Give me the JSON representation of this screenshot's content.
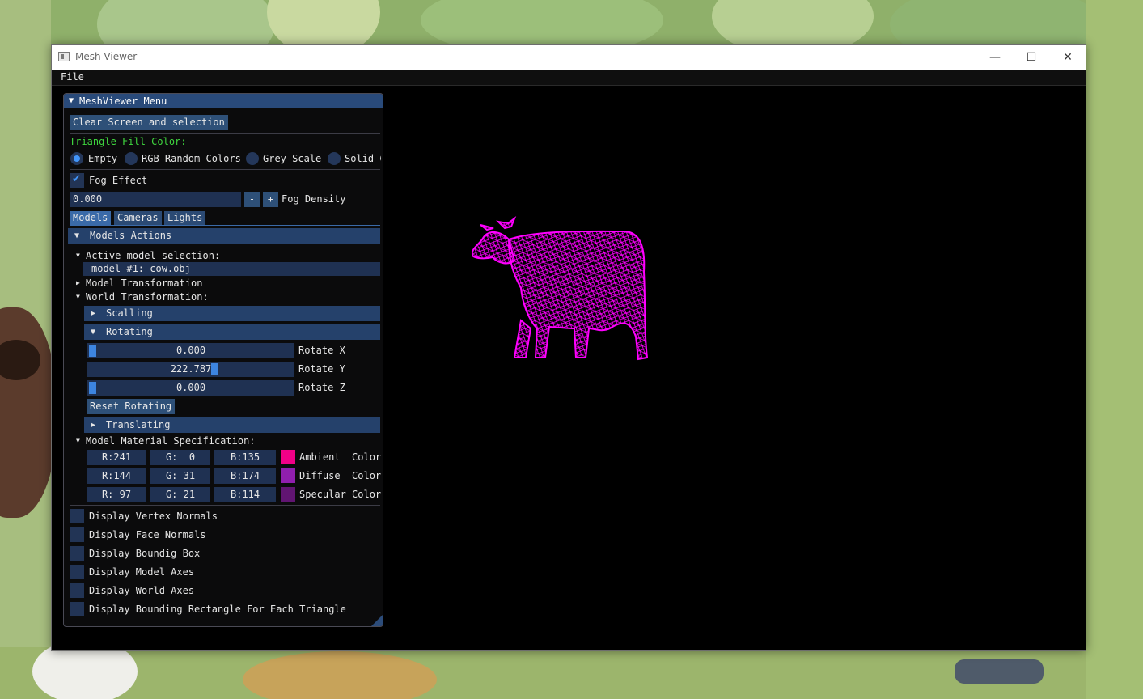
{
  "window": {
    "title": "Mesh Viewer",
    "controls": {
      "minimize": "—",
      "maximize": "☐",
      "close": "✕"
    }
  },
  "menubar": {
    "file": "File"
  },
  "panel": {
    "title": "MeshViewer Menu",
    "clear_button": "Clear Screen and selection",
    "fill_color_label": "Triangle Fill Color:",
    "fill_options": [
      "Empty",
      "RGB Random Colors",
      "Grey Scale",
      "Solid C"
    ],
    "fill_selected": "Empty",
    "fog": {
      "label": "Fog Effect",
      "checked": true,
      "density_value": "0.000",
      "minus": "-",
      "plus": "+",
      "density_label": "Fog Density"
    },
    "tabs": [
      "Models",
      "Cameras",
      "Lights"
    ],
    "active_tab": "Models",
    "models_actions": {
      "header": "Models Actions",
      "active_selection_label": "Active model selection:",
      "active_model": "model #1: cow.obj",
      "model_transformation": "Model Transformation",
      "world_transformation": "World Transformation:",
      "scalling": "Scalling",
      "rotating": "Rotating",
      "rotate": [
        {
          "value": "0.000",
          "label": "Rotate X",
          "fraction": 0.0
        },
        {
          "value": "222.787",
          "label": "Rotate Y",
          "fraction": 0.62
        },
        {
          "value": "0.000",
          "label": "Rotate Z",
          "fraction": 0.0
        }
      ],
      "reset_rotating": "Reset Rotating",
      "translating": "Translating",
      "material_label": "Model Material Specification:",
      "materials": [
        {
          "r": "R:241",
          "g": "G:  0",
          "b": "B:135",
          "label": "Ambient  Color",
          "color": "#f10087"
        },
        {
          "r": "R:144",
          "g": "G: 31",
          "b": "B:174",
          "label": "Diffuse  Color",
          "color": "#901fae"
        },
        {
          "r": "R: 97",
          "g": "G: 21",
          "b": "B:114",
          "label": "Specular Color",
          "color": "#611572"
        }
      ]
    },
    "display_options": [
      "Display Vertex Normals",
      "Display Face Normals",
      "Display Boundig Box",
      "Display Model Axes",
      "Display World Axes",
      "Display Bounding Rectangle For Each Triangle"
    ]
  },
  "viewport": {
    "mesh_color": "#ff00ff"
  },
  "colors": {
    "accent": "#4296fa",
    "header": "#294a7a",
    "frame": "#1f3152"
  }
}
